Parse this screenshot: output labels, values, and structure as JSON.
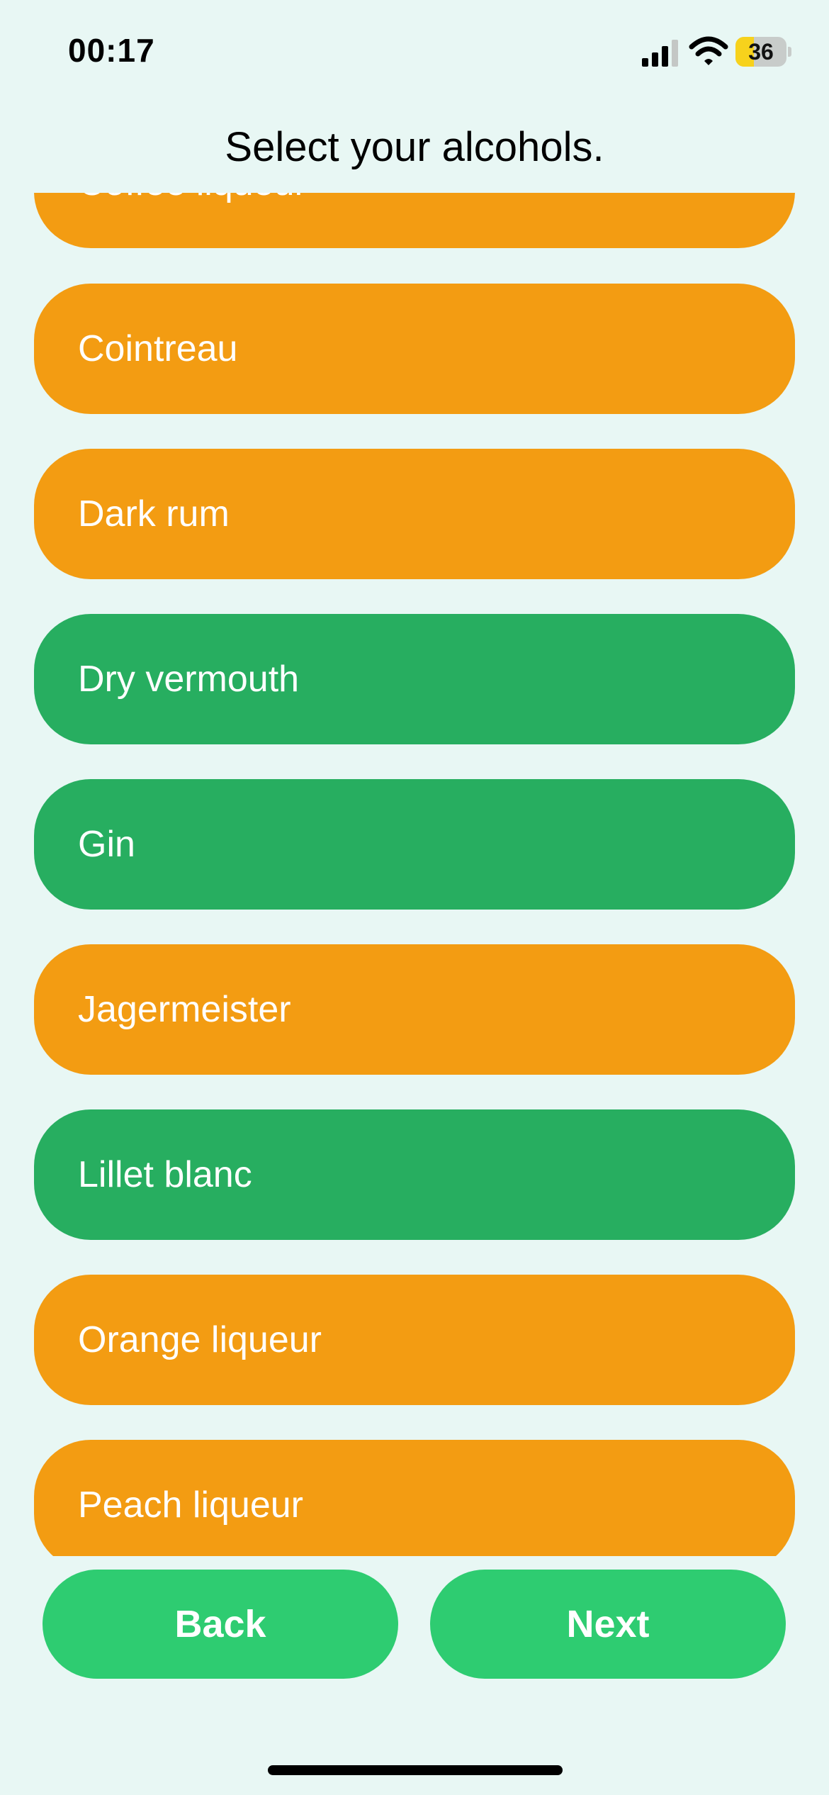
{
  "status_bar": {
    "time": "00:17",
    "battery_level": "36",
    "battery_fraction": 0.36,
    "icons": [
      "signal-icon",
      "wifi-icon",
      "battery-icon"
    ]
  },
  "title": "Select your alcohols.",
  "colors": {
    "background": "#e8f7f4",
    "unselected": "#f39c12",
    "selected": "#27ae60",
    "nav_button": "#2ecc71"
  },
  "options": [
    {
      "label": "Coffee liqueur",
      "selected": false
    },
    {
      "label": "Cointreau",
      "selected": false
    },
    {
      "label": "Dark rum",
      "selected": false
    },
    {
      "label": "Dry vermouth",
      "selected": true
    },
    {
      "label": "Gin",
      "selected": true
    },
    {
      "label": "Jagermeister",
      "selected": false
    },
    {
      "label": "Lillet blanc",
      "selected": true
    },
    {
      "label": "Orange liqueur",
      "selected": false
    },
    {
      "label": "Peach liqueur",
      "selected": false
    }
  ],
  "buttons": {
    "back": "Back",
    "next": "Next"
  }
}
